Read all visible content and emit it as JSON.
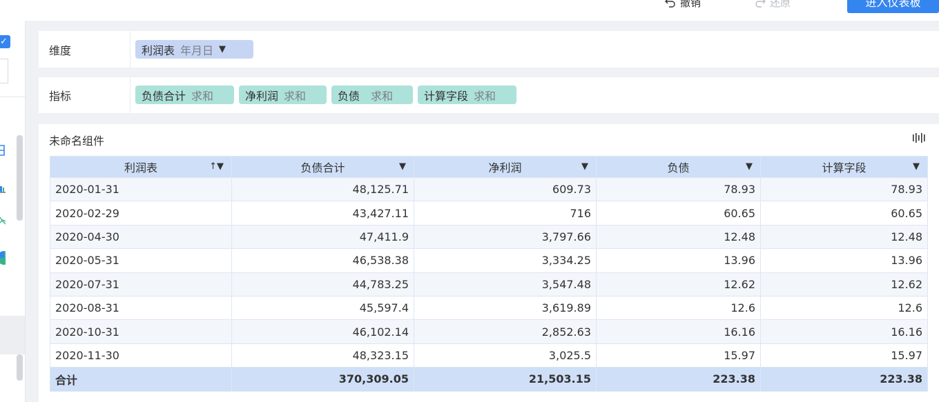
{
  "toolbar": {
    "undo_label": "撤销",
    "redo_label": "还原",
    "enter_dashboard_label": "进入仪表板"
  },
  "dimension_panel": {
    "label": "维度",
    "field": {
      "name": "利润表",
      "granularity": "年月日"
    }
  },
  "indicator_panel": {
    "label": "指标",
    "fields": [
      {
        "name": "负债合计",
        "agg": "求和"
      },
      {
        "name": "净利润",
        "agg": "求和"
      },
      {
        "name": "负债",
        "agg": "求和"
      },
      {
        "name": "计算字段",
        "agg": "求和"
      }
    ]
  },
  "component": {
    "title": "未命名组件"
  },
  "table": {
    "headers": [
      "利润表",
      "负债合计",
      "净利润",
      "负债",
      "计算字段"
    ],
    "rows": [
      [
        "2020-01-31",
        "48,125.71",
        "609.73",
        "78.93",
        "78.93"
      ],
      [
        "2020-02-29",
        "43,427.11",
        "716",
        "60.65",
        "60.65"
      ],
      [
        "2020-04-30",
        "47,411.9",
        "3,797.66",
        "12.48",
        "12.48"
      ],
      [
        "2020-05-31",
        "46,538.38",
        "3,334.25",
        "13.96",
        "13.96"
      ],
      [
        "2020-07-31",
        "44,783.25",
        "3,547.48",
        "12.62",
        "12.62"
      ],
      [
        "2020-08-31",
        "45,597.4",
        "3,619.89",
        "12.6",
        "12.6"
      ],
      [
        "2020-10-31",
        "46,102.14",
        "2,852.63",
        "16.16",
        "16.16"
      ],
      [
        "2020-11-30",
        "48,323.15",
        "3,025.5",
        "15.97",
        "15.97"
      ]
    ],
    "total": [
      "合计",
      "370,309.05",
      "21,503.15",
      "223.38",
      "223.38"
    ]
  },
  "colors": {
    "primary": "#3585f0",
    "header_bg": "#cfdff8",
    "dimension_pill": "#c6d5f3",
    "indicator_pill": "#ade2da"
  }
}
